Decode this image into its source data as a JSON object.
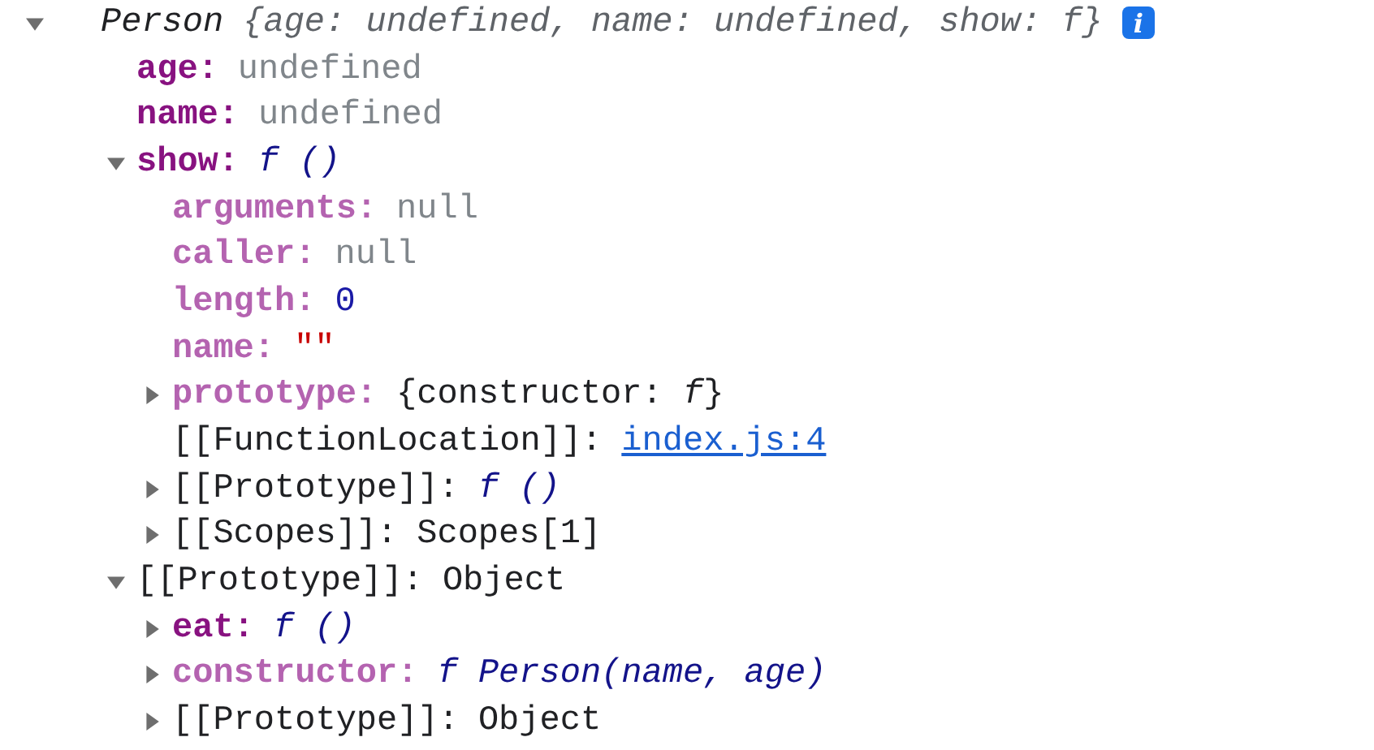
{
  "tree": [
    {
      "key": "Person",
      "value": "{age: undefined, name: undefined, show: f}",
      "kind": "preview",
      "info": "i",
      "expanded": true,
      "children": [
        {
          "key": "age:",
          "internal": false,
          "enumerable": true,
          "value": "undefined",
          "kind": "undefined"
        },
        {
          "key": "name:",
          "internal": false,
          "enumerable": true,
          "value": "undefined",
          "kind": "undefined"
        },
        {
          "key": "show:",
          "internal": false,
          "enumerable": true,
          "value": "f ()",
          "kind": "function",
          "expanded": true,
          "children": [
            {
              "key": "arguments:",
              "internal": false,
              "enumerable": false,
              "value": "null",
              "kind": "null"
            },
            {
              "key": "caller:",
              "internal": false,
              "enumerable": false,
              "value": "null",
              "kind": "null"
            },
            {
              "key": "length:",
              "internal": false,
              "enumerable": false,
              "value": "0",
              "kind": "number"
            },
            {
              "key": "name:",
              "internal": false,
              "enumerable": false,
              "value": "\"\"",
              "kind": "string"
            },
            {
              "key": "prototype:",
              "internal": false,
              "enumerable": false,
              "value": "{constructor: *f*}",
              "kind": "object",
              "expanded": false
            },
            {
              "key": "[[FunctionLocation]]:",
              "internal": true,
              "value": "index.js:4",
              "kind": "link"
            },
            {
              "key": "[[Prototype]]:",
              "internal": true,
              "value": "f ()",
              "kind": "function",
              "expanded": false
            },
            {
              "key": "[[Scopes]]:",
              "internal": true,
              "value": "Scopes[1]",
              "kind": "object",
              "expanded": false
            }
          ]
        },
        {
          "key": "[[Prototype]]:",
          "internal": true,
          "value": "Object",
          "kind": "object",
          "expanded": true,
          "children": [
            {
              "key": "eat:",
              "internal": false,
              "enumerable": true,
              "value": "f ()",
              "kind": "function",
              "expanded": false
            },
            {
              "key": "constructor:",
              "internal": false,
              "enumerable": false,
              "value": "f Person(name, age)",
              "kind": "function",
              "expanded": false
            },
            {
              "key": "[[Prototype]]:",
              "internal": true,
              "value": "Object",
              "kind": "object",
              "expanded": false
            }
          ]
        }
      ]
    }
  ]
}
